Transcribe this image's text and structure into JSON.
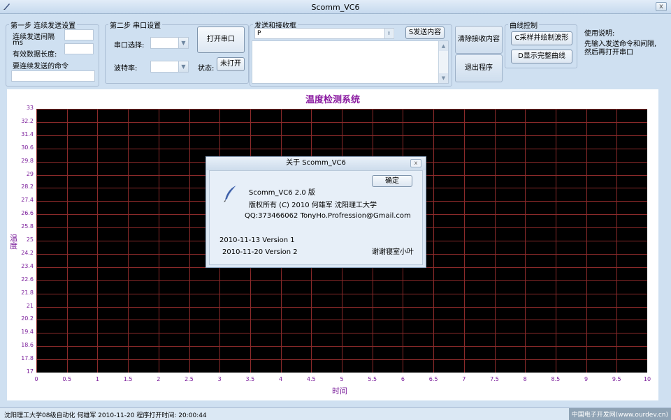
{
  "window": {
    "title": "Scomm_VC6",
    "close_glyph": "x",
    "app_icon": "pen-icon"
  },
  "step1": {
    "legend": "第一步 连续发送设置",
    "interval_label": "连续发送间隔",
    "interval_unit": "ms",
    "data_length_label": "有效数据长度:",
    "command_label": "要连续发送的命令",
    "interval_value": "",
    "data_length_value": "",
    "command_value": ""
  },
  "step2": {
    "legend": "第二步 串口设置",
    "port_label": "串口选择:",
    "baud_label": "波特率:",
    "open_button": "打开串口",
    "state_label": "状态:",
    "state_value": "未打开",
    "port_value": "",
    "baud_value": ""
  },
  "sendrecv": {
    "legend": "发送和接收框",
    "send_value": "P",
    "send_button": "S发送内容",
    "receive_value": ""
  },
  "actions": {
    "clear_button": "清除接收内容",
    "exit_button": "退出程序"
  },
  "curve": {
    "legend": "曲线控制",
    "sample_button": "C采样并绘制波形",
    "full_button": "D显示完整曲线"
  },
  "help": {
    "title": "使用说明:",
    "line1": "先输入发送命令和间隔,",
    "line2": "然后再打开串口"
  },
  "chart_data": {
    "type": "line",
    "title": "温度检测系统",
    "xlabel": "时间",
    "ylabel": "温度",
    "xlim": [
      0,
      10
    ],
    "ylim": [
      17,
      33
    ],
    "xticks": [
      "0",
      "0.5",
      "1",
      "1.5",
      "2",
      "2.5",
      "3",
      "3.5",
      "4",
      "4.5",
      "5",
      "5.5",
      "6",
      "6.5",
      "7",
      "7.5",
      "8",
      "8.5",
      "9",
      "9.5",
      "10"
    ],
    "yticks": [
      "33",
      "32.2",
      "31.4",
      "30.6",
      "29.8",
      "29",
      "28.2",
      "27.4",
      "26.6",
      "25.8",
      "25",
      "24.2",
      "23.4",
      "22.6",
      "21.8",
      "21",
      "20.2",
      "19.4",
      "18.6",
      "17.8",
      "17"
    ],
    "grid": true,
    "series": [],
    "colors": {
      "background": "#000000",
      "grid": "#8b2a2a",
      "text": "#7a1c9a"
    }
  },
  "status": {
    "text": "沈阳理工大学08级自动化 何雄军 2010-11-20   程序打开时间: 20:00:44",
    "watermark": "中国电子开发网(www.ourdev.cn)"
  },
  "about": {
    "title": "关于 Scomm_VC6",
    "close_glyph": "x",
    "icon": "quill-pen-icon",
    "version": "Scomm_VC6 2.0 版",
    "copyright": "版权所有 (C) 2010  何雄军 沈阳理工大学",
    "contact": "QQ:373466062    TonyHo.Profression@Gmail.com",
    "history1": "2010-11-13 Version 1",
    "history2": "2010-11-20  Version 2",
    "thanks": "谢谢寝室小叶",
    "ok_button": "确定"
  }
}
